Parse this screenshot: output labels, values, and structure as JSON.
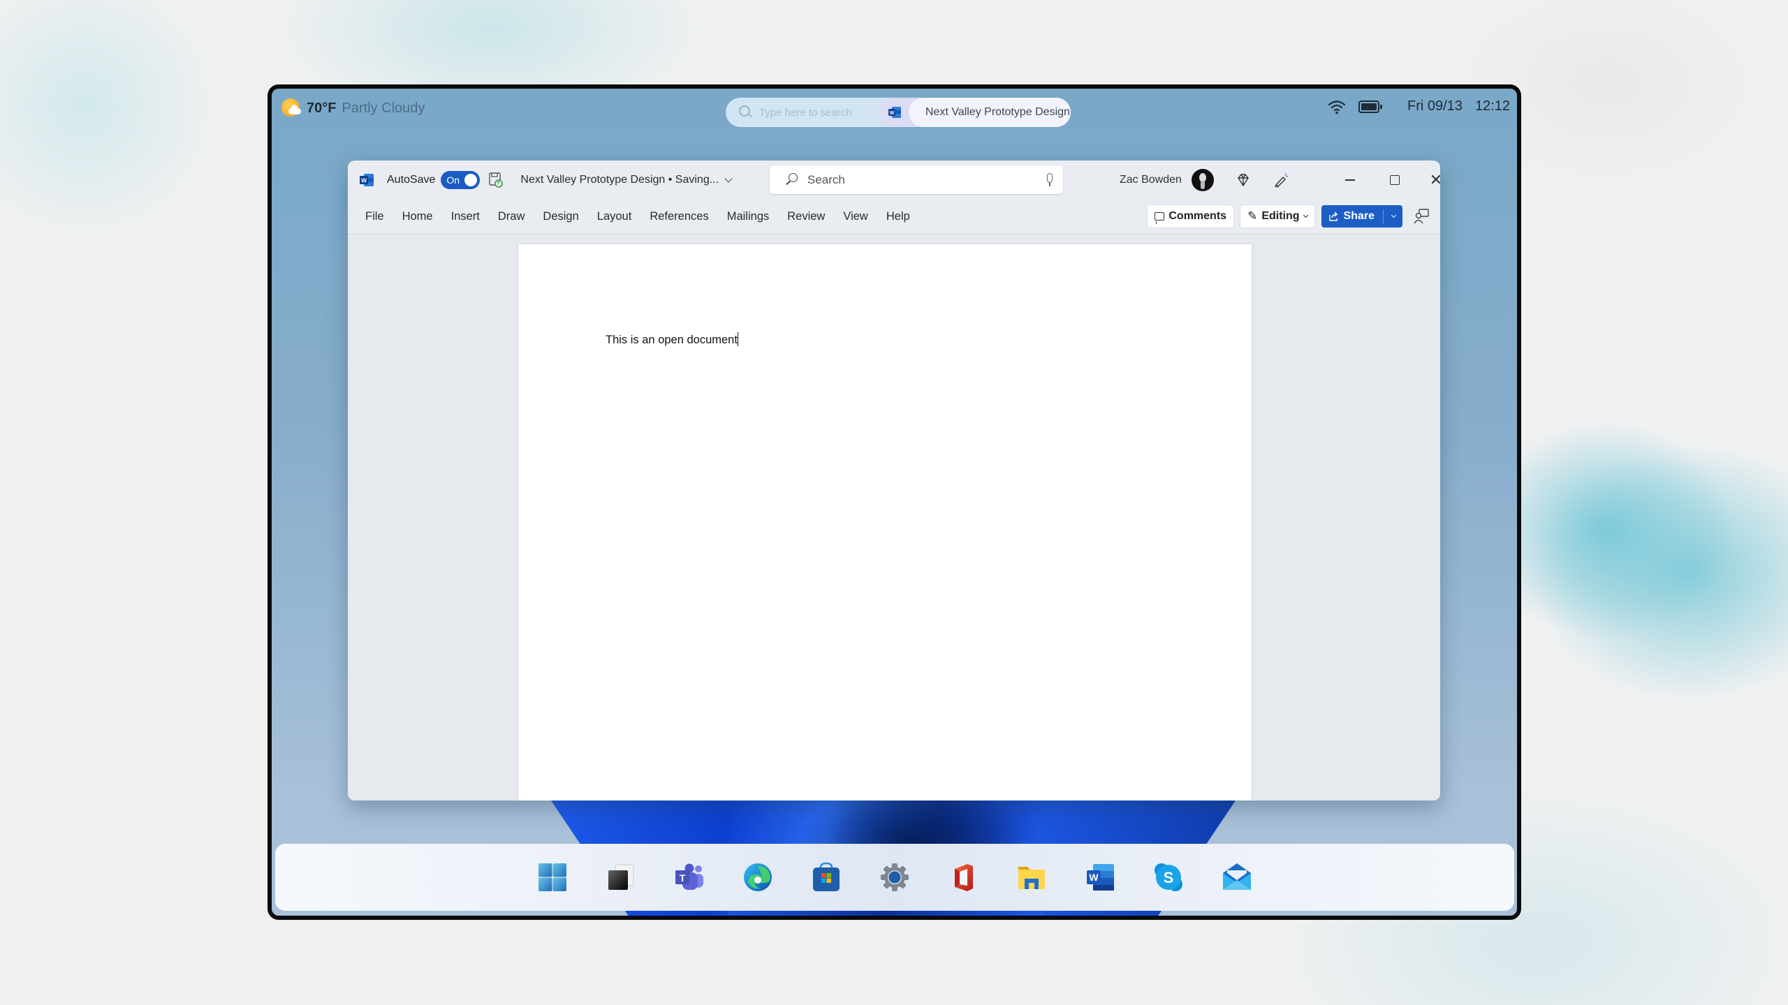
{
  "statusbar": {
    "temperature": "70°F",
    "condition": "Partly Cloudy",
    "search_placeholder": "Type here to search",
    "active_document": "Next Valley Prototype Design",
    "date": "Fri 09/13",
    "time": "12:12"
  },
  "word": {
    "autosave_label": "AutoSave",
    "autosave_state": "On",
    "document_title": "Next Valley Prototype Design • Saving...",
    "search_placeholder": "Search",
    "user_name": "Zac Bowden",
    "menu": [
      "File",
      "Home",
      "Insert",
      "Draw",
      "Design",
      "Layout",
      "References",
      "Mailings",
      "Review",
      "View",
      "Help"
    ],
    "comments_label": "Comments",
    "editing_label": "Editing",
    "share_label": "Share",
    "document_body": "This is an open document",
    "accent_color": "#1c5ec6"
  },
  "taskbar": {
    "apps": [
      {
        "name": "start",
        "icon": "windows-logo-icon"
      },
      {
        "name": "task-view",
        "icon": "task-view-icon"
      },
      {
        "name": "teams",
        "icon": "teams-icon"
      },
      {
        "name": "edge",
        "icon": "edge-icon"
      },
      {
        "name": "store",
        "icon": "store-icon"
      },
      {
        "name": "settings",
        "icon": "gear-icon"
      },
      {
        "name": "office",
        "icon": "office-icon"
      },
      {
        "name": "file-explorer",
        "icon": "folder-icon"
      },
      {
        "name": "word",
        "icon": "word-icon"
      },
      {
        "name": "skype",
        "icon": "skype-icon"
      },
      {
        "name": "mail",
        "icon": "mail-icon"
      }
    ]
  }
}
